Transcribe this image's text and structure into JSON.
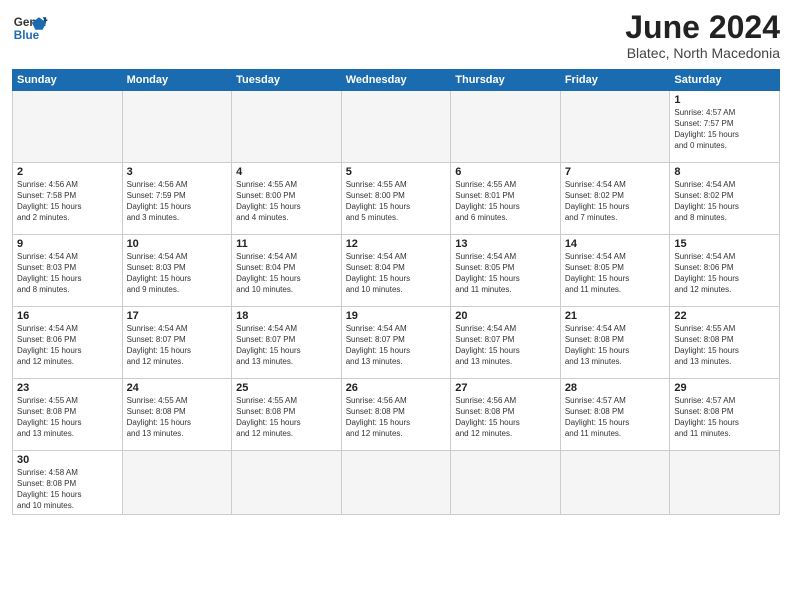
{
  "header": {
    "logo": {
      "line1": "General",
      "line2": "Blue"
    },
    "title": "June 2024",
    "subtitle": "Blatec, North Macedonia"
  },
  "weekdays": [
    "Sunday",
    "Monday",
    "Tuesday",
    "Wednesday",
    "Thursday",
    "Friday",
    "Saturday"
  ],
  "weeks": [
    [
      {
        "day": "",
        "info": ""
      },
      {
        "day": "",
        "info": ""
      },
      {
        "day": "",
        "info": ""
      },
      {
        "day": "",
        "info": ""
      },
      {
        "day": "",
        "info": ""
      },
      {
        "day": "",
        "info": ""
      },
      {
        "day": "1",
        "info": "Sunrise: 4:57 AM\nSunset: 7:57 PM\nDaylight: 15 hours\nand 0 minutes."
      }
    ],
    [
      {
        "day": "2",
        "info": "Sunrise: 4:56 AM\nSunset: 7:58 PM\nDaylight: 15 hours\nand 2 minutes."
      },
      {
        "day": "3",
        "info": "Sunrise: 4:56 AM\nSunset: 7:59 PM\nDaylight: 15 hours\nand 3 minutes."
      },
      {
        "day": "4",
        "info": "Sunrise: 4:55 AM\nSunset: 8:00 PM\nDaylight: 15 hours\nand 4 minutes."
      },
      {
        "day": "5",
        "info": "Sunrise: 4:55 AM\nSunset: 8:00 PM\nDaylight: 15 hours\nand 5 minutes."
      },
      {
        "day": "6",
        "info": "Sunrise: 4:55 AM\nSunset: 8:01 PM\nDaylight: 15 hours\nand 6 minutes."
      },
      {
        "day": "7",
        "info": "Sunrise: 4:54 AM\nSunset: 8:02 PM\nDaylight: 15 hours\nand 7 minutes."
      },
      {
        "day": "8",
        "info": "Sunrise: 4:54 AM\nSunset: 8:02 PM\nDaylight: 15 hours\nand 8 minutes."
      }
    ],
    [
      {
        "day": "9",
        "info": "Sunrise: 4:54 AM\nSunset: 8:03 PM\nDaylight: 15 hours\nand 8 minutes."
      },
      {
        "day": "10",
        "info": "Sunrise: 4:54 AM\nSunset: 8:03 PM\nDaylight: 15 hours\nand 9 minutes."
      },
      {
        "day": "11",
        "info": "Sunrise: 4:54 AM\nSunset: 8:04 PM\nDaylight: 15 hours\nand 10 minutes."
      },
      {
        "day": "12",
        "info": "Sunrise: 4:54 AM\nSunset: 8:04 PM\nDaylight: 15 hours\nand 10 minutes."
      },
      {
        "day": "13",
        "info": "Sunrise: 4:54 AM\nSunset: 8:05 PM\nDaylight: 15 hours\nand 11 minutes."
      },
      {
        "day": "14",
        "info": "Sunrise: 4:54 AM\nSunset: 8:05 PM\nDaylight: 15 hours\nand 11 minutes."
      },
      {
        "day": "15",
        "info": "Sunrise: 4:54 AM\nSunset: 8:06 PM\nDaylight: 15 hours\nand 12 minutes."
      }
    ],
    [
      {
        "day": "16",
        "info": "Sunrise: 4:54 AM\nSunset: 8:06 PM\nDaylight: 15 hours\nand 12 minutes."
      },
      {
        "day": "17",
        "info": "Sunrise: 4:54 AM\nSunset: 8:07 PM\nDaylight: 15 hours\nand 12 minutes."
      },
      {
        "day": "18",
        "info": "Sunrise: 4:54 AM\nSunset: 8:07 PM\nDaylight: 15 hours\nand 13 minutes."
      },
      {
        "day": "19",
        "info": "Sunrise: 4:54 AM\nSunset: 8:07 PM\nDaylight: 15 hours\nand 13 minutes."
      },
      {
        "day": "20",
        "info": "Sunrise: 4:54 AM\nSunset: 8:07 PM\nDaylight: 15 hours\nand 13 minutes."
      },
      {
        "day": "21",
        "info": "Sunrise: 4:54 AM\nSunset: 8:08 PM\nDaylight: 15 hours\nand 13 minutes."
      },
      {
        "day": "22",
        "info": "Sunrise: 4:55 AM\nSunset: 8:08 PM\nDaylight: 15 hours\nand 13 minutes."
      }
    ],
    [
      {
        "day": "23",
        "info": "Sunrise: 4:55 AM\nSunset: 8:08 PM\nDaylight: 15 hours\nand 13 minutes."
      },
      {
        "day": "24",
        "info": "Sunrise: 4:55 AM\nSunset: 8:08 PM\nDaylight: 15 hours\nand 13 minutes."
      },
      {
        "day": "25",
        "info": "Sunrise: 4:55 AM\nSunset: 8:08 PM\nDaylight: 15 hours\nand 12 minutes."
      },
      {
        "day": "26",
        "info": "Sunrise: 4:56 AM\nSunset: 8:08 PM\nDaylight: 15 hours\nand 12 minutes."
      },
      {
        "day": "27",
        "info": "Sunrise: 4:56 AM\nSunset: 8:08 PM\nDaylight: 15 hours\nand 12 minutes."
      },
      {
        "day": "28",
        "info": "Sunrise: 4:57 AM\nSunset: 8:08 PM\nDaylight: 15 hours\nand 11 minutes."
      },
      {
        "day": "29",
        "info": "Sunrise: 4:57 AM\nSunset: 8:08 PM\nDaylight: 15 hours\nand 11 minutes."
      }
    ],
    [
      {
        "day": "30",
        "info": "Sunrise: 4:58 AM\nSunset: 8:08 PM\nDaylight: 15 hours\nand 10 minutes."
      },
      {
        "day": "",
        "info": ""
      },
      {
        "day": "",
        "info": ""
      },
      {
        "day": "",
        "info": ""
      },
      {
        "day": "",
        "info": ""
      },
      {
        "day": "",
        "info": ""
      },
      {
        "day": "",
        "info": ""
      }
    ]
  ]
}
